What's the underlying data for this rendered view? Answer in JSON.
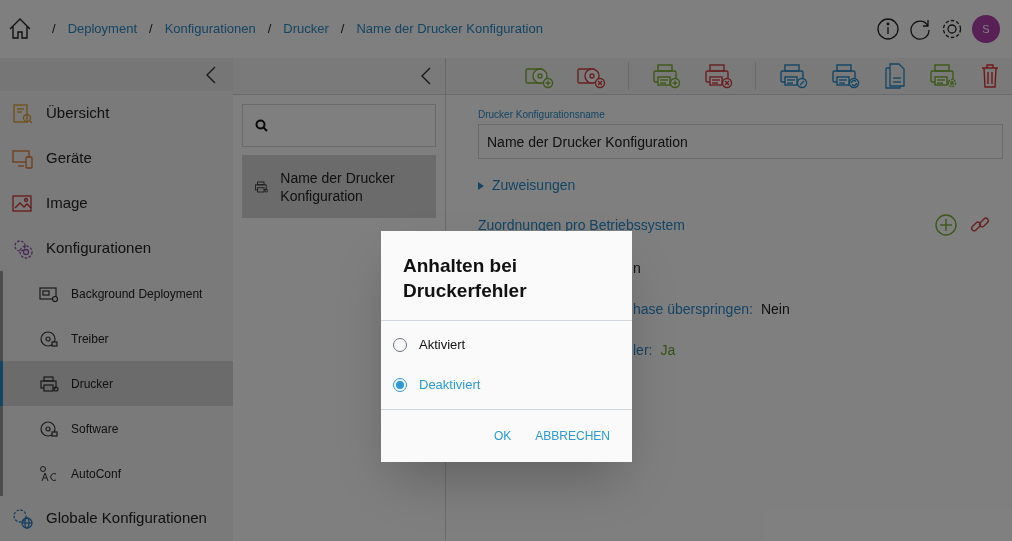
{
  "breadcrumb": [
    {
      "separator": "/",
      "label": "Deployment"
    },
    {
      "separator": "/",
      "label": "Konfigurationen"
    },
    {
      "separator": "/",
      "label": "Drucker"
    },
    {
      "separator": "/",
      "label": "Name der Drucker Konfiguration"
    }
  ],
  "avatar": "S",
  "sidebar": {
    "items": [
      {
        "label": "Übersicht",
        "selected": false,
        "kind": "overview"
      },
      {
        "label": "Geräte",
        "selected": false,
        "kind": "devices"
      },
      {
        "label": "Image",
        "selected": false,
        "kind": "image"
      },
      {
        "label": "Konfigurationen",
        "selected": false,
        "kind": "gears",
        "children": [
          {
            "label": "Background Deployment",
            "selected": false,
            "kind": "background"
          },
          {
            "label": "Treiber",
            "selected": false,
            "kind": "disc"
          },
          {
            "label": "Drucker",
            "selected": true,
            "kind": "printer"
          },
          {
            "label": "Software",
            "selected": false,
            "kind": "disc"
          },
          {
            "label": "AutoConf",
            "selected": false,
            "kind": "autoconf"
          }
        ]
      },
      {
        "label": "Globale Konfigurationen",
        "selected": false,
        "kind": "globe"
      }
    ]
  },
  "list": {
    "items": [
      {
        "label": "Name der Drucker Konfiguration",
        "selected": true
      }
    ]
  },
  "form": {
    "name_field": {
      "label": "Drucker Konfigurationsname",
      "value": "Name der Drucker Konfiguration"
    },
    "assignments": {
      "label": "Zuweisungen",
      "expanded": false
    },
    "os_section": {
      "title": "Zuordnungen pro Betriebssystem"
    },
    "properties": [
      {
        "value": "n",
        "kind": "plain"
      },
      {
        "label": "hase überspringen:",
        "value": "Nein",
        "kind": "plain"
      },
      {
        "label": "ler:",
        "value": "Ja",
        "kind": "positive"
      }
    ]
  },
  "dialog": {
    "title": "Anhalten bei Druckerfehler",
    "options": [
      {
        "label": "Aktiviert",
        "selected": false
      },
      {
        "label": "Deaktiviert",
        "selected": true
      }
    ],
    "buttons": [
      "OK",
      "ABBRECHEN"
    ]
  }
}
